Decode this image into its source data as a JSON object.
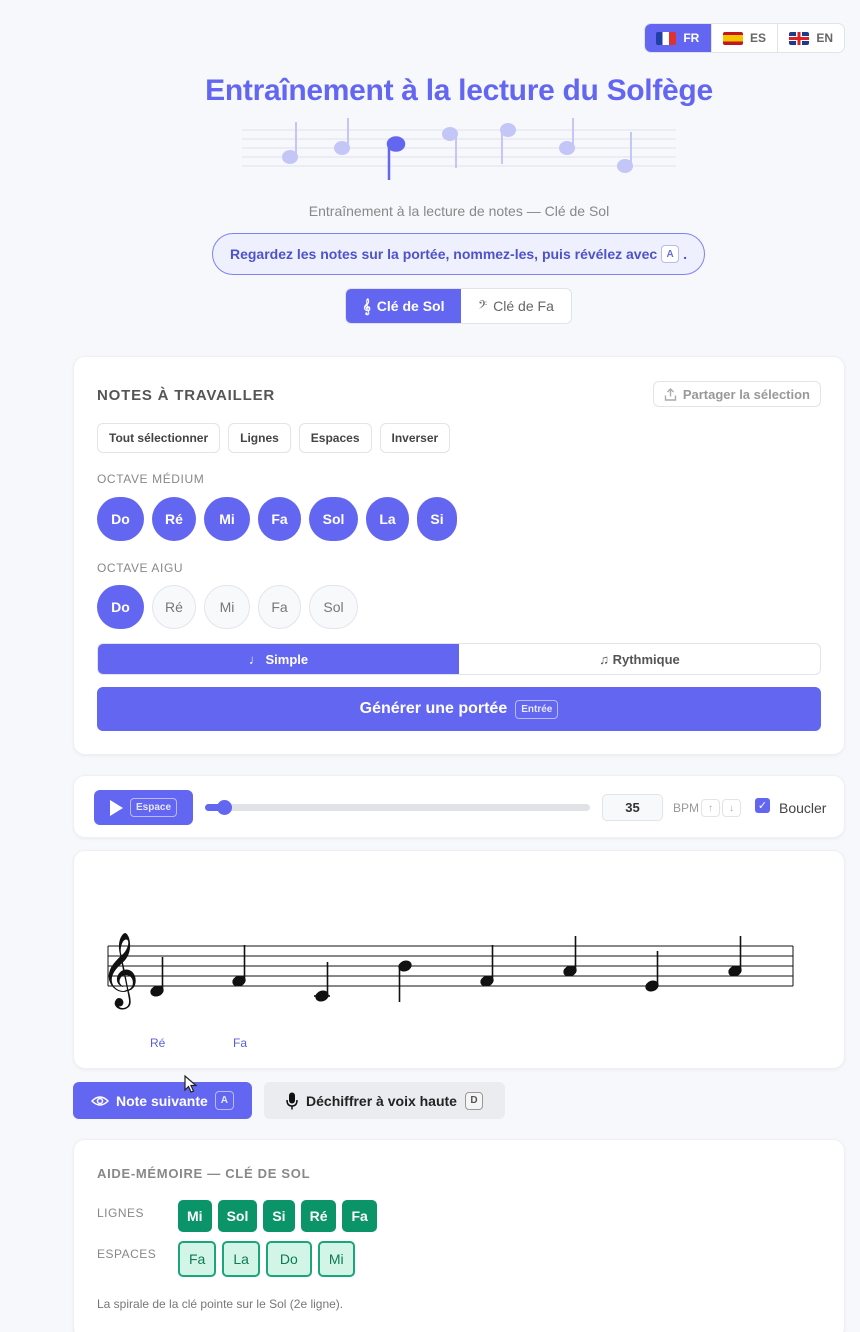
{
  "languages": [
    {
      "code": "FR",
      "flag": "flag-fr",
      "active": true
    },
    {
      "code": "ES",
      "flag": "flag-es",
      "active": false
    },
    {
      "code": "EN",
      "flag": "flag-en",
      "active": false
    }
  ],
  "header": {
    "title": "Entraînement à la lecture du Solfège",
    "subtitle": "Entraînement à la lecture de notes — Clé de Sol",
    "hint_text": "Regardez les notes sur la portée, nommez-les, puis révélez avec",
    "hint_key": "A",
    "hint_end": "."
  },
  "clef": {
    "treble_label": "Clé de Sol",
    "treble_icon": "𝄞",
    "bass_label": "Clé de Fa",
    "bass_icon": "𝄢"
  },
  "selection": {
    "title": "NOTES À TRAVAILLER",
    "share_label": "Partager la sélection",
    "quick_buttons": [
      "Tout sélectionner",
      "Lignes",
      "Espaces",
      "Inverser"
    ],
    "medium_label": "OCTAVE MÉDIUM",
    "medium_notes": [
      {
        "name": "Do",
        "selected": true
      },
      {
        "name": "Ré",
        "selected": true
      },
      {
        "name": "Mi",
        "selected": true
      },
      {
        "name": "Fa",
        "selected": true
      },
      {
        "name": "Sol",
        "selected": true
      },
      {
        "name": "La",
        "selected": true
      },
      {
        "name": "Si",
        "selected": true
      }
    ],
    "high_label": "OCTAVE AIGU",
    "high_notes": [
      {
        "name": "Do",
        "selected": true
      },
      {
        "name": "Ré",
        "selected": false
      },
      {
        "name": "Mi",
        "selected": false
      },
      {
        "name": "Fa",
        "selected": false
      },
      {
        "name": "Sol",
        "selected": false
      }
    ],
    "mode_simple": "♩ Simple",
    "mode_rhythmic": "♫ Rythmique",
    "generate_label": "Générer une portée",
    "generate_key": "Entrée"
  },
  "player": {
    "play_key": "Espace",
    "tempo_fraction": 0.05,
    "bpm": "35",
    "bpm_label": "BPM",
    "bpm_up": "↑",
    "bpm_down": "↓",
    "loop_checked": true,
    "loop_label": "Boucler"
  },
  "score": {
    "notes": [
      "Ré",
      "Fa",
      "Do",
      "Si",
      "Fa",
      "La",
      "Mi",
      "La"
    ],
    "revealed_labels": [
      "Ré",
      "Fa"
    ]
  },
  "actions": {
    "reveal_label": "Note suivante",
    "reveal_key": "A",
    "decode_label": "Déchiffrer à voix haute",
    "decode_key": "D"
  },
  "memo": {
    "title": "AIDE-MÉMOIRE — CLÉ DE SOL",
    "lines_label": "LIGNES",
    "lines": [
      "Mi",
      "Sol",
      "Si",
      "Ré",
      "Fa"
    ],
    "spaces_label": "ESPACES",
    "spaces": [
      "Fa",
      "La",
      "Do",
      "Mi"
    ],
    "note": "La spirale de la clé pointe sur le Sol (2e ligne)."
  },
  "colors": {
    "accent": "#6366f1",
    "line_chip": "#0b9467",
    "space_chip": "#d3f5e8"
  }
}
